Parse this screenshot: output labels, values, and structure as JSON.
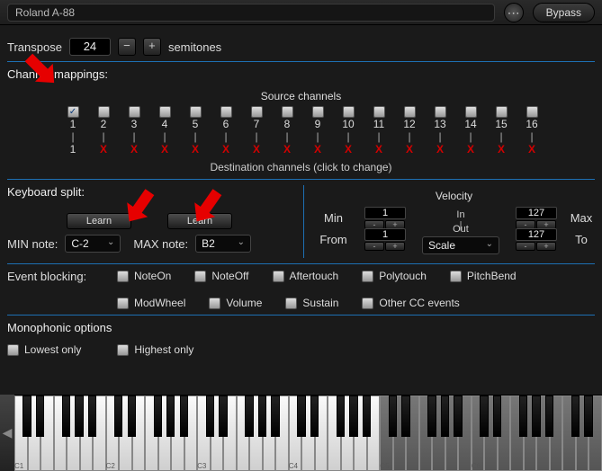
{
  "header": {
    "title": "Roland A-88",
    "bypass_label": "Bypass"
  },
  "transpose": {
    "label": "Transpose",
    "value": "24",
    "unit": "semitones"
  },
  "channels": {
    "section_label": "Channel mappings:",
    "source_label": "Source channels",
    "numbers": [
      "1",
      "2",
      "3",
      "4",
      "5",
      "6",
      "7",
      "8",
      "9",
      "10",
      "11",
      "12",
      "13",
      "14",
      "15",
      "16"
    ],
    "dest_first": "1",
    "dest_x": "X",
    "dest_note": "Destination channels (click to change)"
  },
  "split": {
    "section_label": "Keyboard split:",
    "learn_label": "Learn",
    "min_label": "MIN note:",
    "min_value": "C-2",
    "max_label": "MAX note:",
    "max_value": "B2"
  },
  "velocity": {
    "title": "Velocity",
    "min_label": "Min",
    "min_value": "1",
    "max_label": "Max",
    "max_value": "127",
    "from_label": "From",
    "from_value": "1",
    "to_label": "To",
    "to_value": "127",
    "in_label": "In",
    "out_label": "Out",
    "mode_value": "Scale"
  },
  "eventblock": {
    "section_label": "Event blocking:",
    "items": [
      "NoteOn",
      "NoteOff",
      "Aftertouch",
      "Polytouch",
      "PitchBend",
      "ModWheel",
      "Volume",
      "Sustain",
      "Other CC events"
    ]
  },
  "mono": {
    "section_label": "Monophonic options",
    "lowest": "Lowest only",
    "highest": "Highest only"
  },
  "keyboard": {
    "octave_labels": [
      "C1",
      "C2",
      "C3",
      "C4",
      "C5",
      "C6"
    ]
  }
}
